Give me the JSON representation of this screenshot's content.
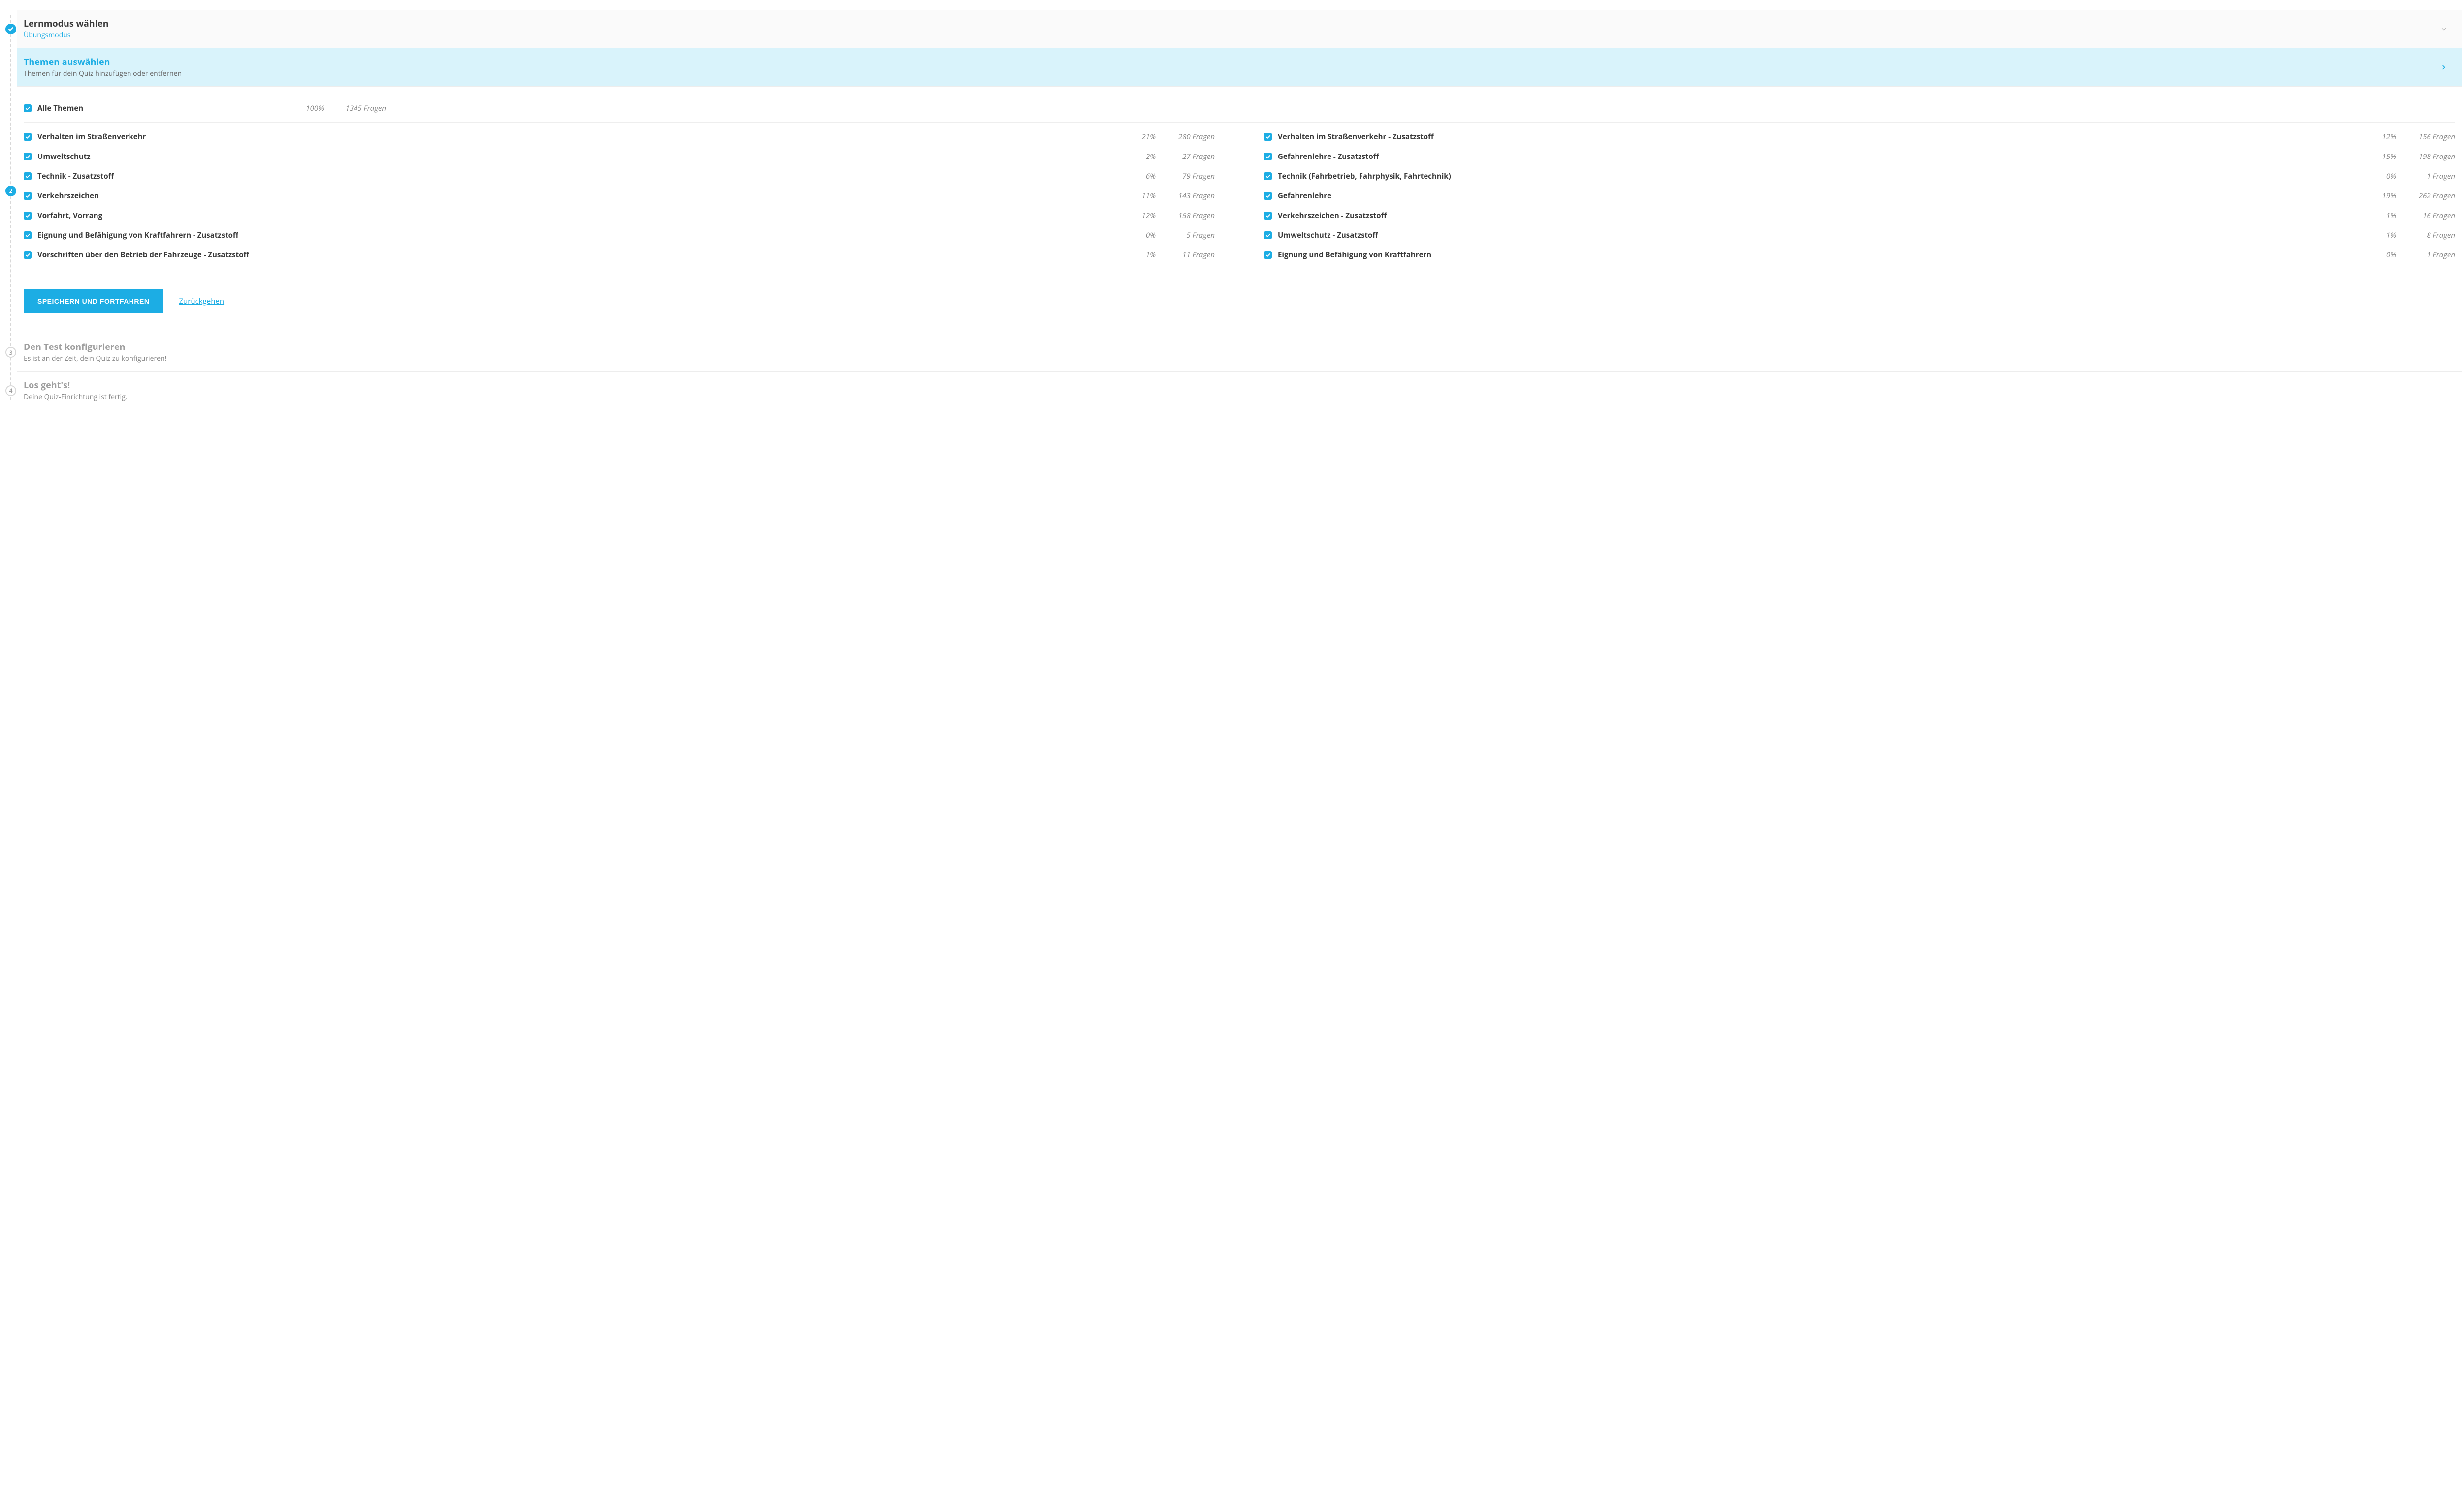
{
  "steps": {
    "s1": {
      "title": "Lernmodus wählen",
      "sub": "Übungsmodus"
    },
    "s2": {
      "num": "2",
      "title": "Themen auswählen",
      "sub": "Themen für dein Quiz hinzufügen oder entfernen"
    },
    "s3": {
      "num": "3",
      "title": "Den Test konfigurieren",
      "sub": "Es ist an der Zeit, dein Quiz zu konfigurieren!"
    },
    "s4": {
      "num": "4",
      "title": "Los geht's!",
      "sub": "Deine Quiz-Einrichtung ist fertig."
    }
  },
  "all": {
    "label": "Alle Themen",
    "pct": "100%",
    "count": "1345 Fragen"
  },
  "left": [
    {
      "label": "Verhalten im Straßenverkehr",
      "pct": "21%",
      "count": "280 Fragen"
    },
    {
      "label": "Umweltschutz",
      "pct": "2%",
      "count": "27 Fragen"
    },
    {
      "label": "Technik - Zusatzstoff",
      "pct": "6%",
      "count": "79 Fragen"
    },
    {
      "label": "Verkehrszeichen",
      "pct": "11%",
      "count": "143 Fragen"
    },
    {
      "label": "Vorfahrt, Vorrang",
      "pct": "12%",
      "count": "158 Fragen"
    },
    {
      "label": "Eignung und Befähigung von Kraftfahrern - Zusatzstoff",
      "pct": "0%",
      "count": "5 Fragen"
    },
    {
      "label": "Vorschriften über den Betrieb der Fahrzeuge - Zusatzstoff",
      "pct": "1%",
      "count": "11 Fragen"
    }
  ],
  "right": [
    {
      "label": "Verhalten im Straßenverkehr - Zusatzstoff",
      "pct": "12%",
      "count": "156 Fragen"
    },
    {
      "label": "Gefahrenlehre - Zusatzstoff",
      "pct": "15%",
      "count": "198 Fragen"
    },
    {
      "label": "Technik (Fahrbetrieb, Fahrphysik, Fahrtechnik)",
      "pct": "0%",
      "count": "1 Fragen"
    },
    {
      "label": "Gefahrenlehre",
      "pct": "19%",
      "count": "262 Fragen"
    },
    {
      "label": "Verkehrszeichen - Zusatzstoff",
      "pct": "1%",
      "count": "16 Fragen"
    },
    {
      "label": "Umweltschutz - Zusatzstoff",
      "pct": "1%",
      "count": "8 Fragen"
    },
    {
      "label": "Eignung und Befähigung von Kraftfahrern",
      "pct": "0%",
      "count": "1 Fragen"
    }
  ],
  "actions": {
    "save": "Speichern und Fortfahren",
    "back": "Zurückgehen"
  }
}
